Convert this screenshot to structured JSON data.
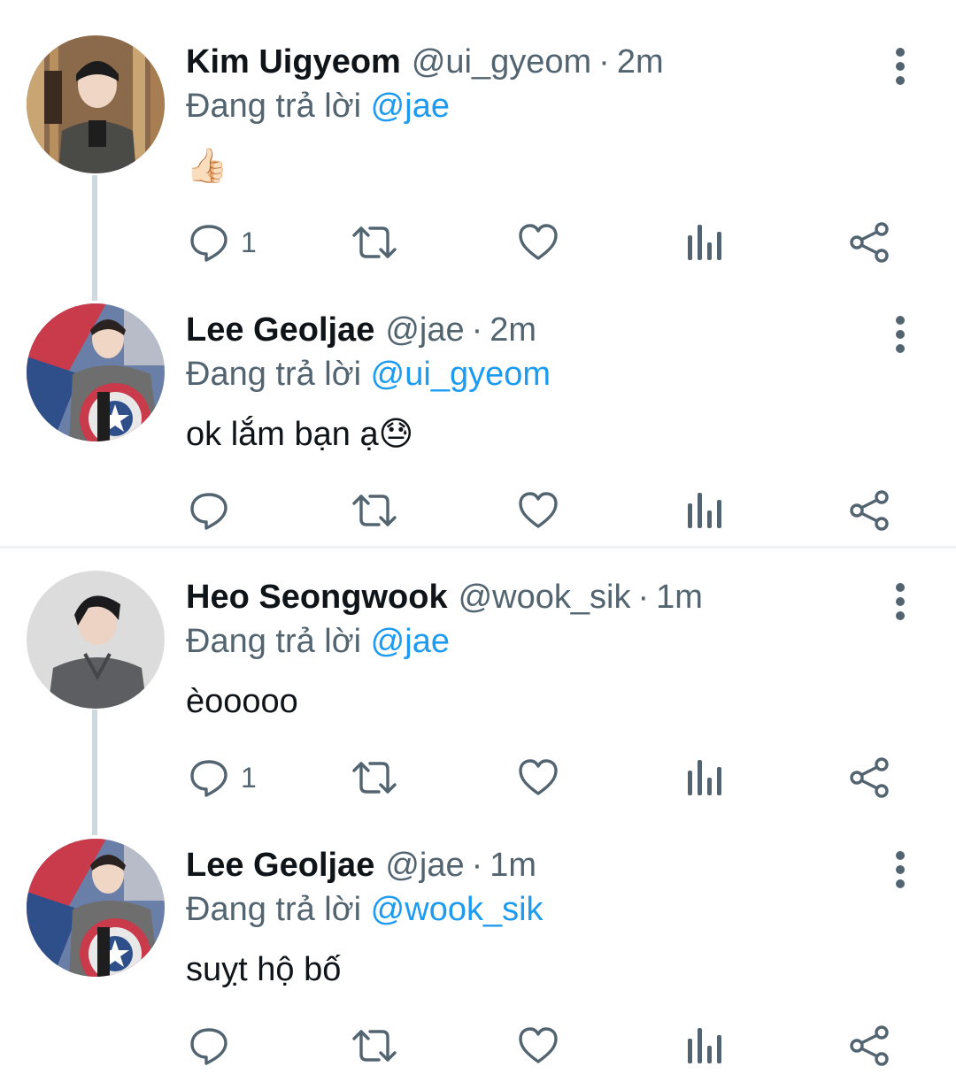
{
  "colors": {
    "text_primary": "#0f1419",
    "text_secondary": "#536471",
    "link": "#1d9bf0",
    "thread_line": "#cfd9de",
    "divider": "#eff3f4"
  },
  "reply_prefix": "Đang trả lời",
  "tweets": [
    {
      "name": "Kim Uigyeom",
      "handle": "@ui_gyeom",
      "dot": "·",
      "time": "2m",
      "reply_to": "@jae",
      "text": "👍🏻",
      "reply_count": "1",
      "avatar_icon": "avatar-photo"
    },
    {
      "name": "Lee Geoljae",
      "handle": "@jae",
      "dot": "·",
      "time": "2m",
      "reply_to": "@ui_gyeom",
      "text": "ok lắm bạn ạ😓",
      "reply_count": "",
      "avatar_icon": "avatar-photo"
    },
    {
      "name": "Heo Seongwook",
      "handle": "@wook_sik",
      "dot": "·",
      "time": "1m",
      "reply_to": "@jae",
      "text": "èooooo",
      "reply_count": "1",
      "avatar_icon": "avatar-photo"
    },
    {
      "name": "Lee Geoljae",
      "handle": "@jae",
      "dot": "·",
      "time": "1m",
      "reply_to": "@wook_sik",
      "text": "suỵt hộ bố",
      "reply_count": "",
      "avatar_icon": "avatar-photo"
    }
  ],
  "action_icons": [
    "reply-icon",
    "retweet-icon",
    "like-icon",
    "analytics-icon",
    "share-icon"
  ]
}
